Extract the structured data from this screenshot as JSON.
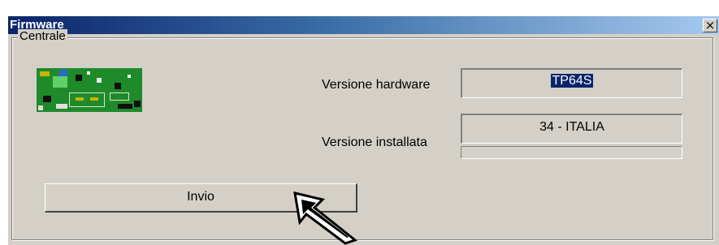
{
  "window": {
    "title": "Firmware",
    "close_symbol": "×"
  },
  "group": {
    "label": "Centrale"
  },
  "hardware": {
    "label": "Versione hardware",
    "value": "TP64S"
  },
  "installed": {
    "label": "Versione installata",
    "value": "34 - ITALIA",
    "progress": 0
  },
  "send_button": {
    "label": "Invio"
  },
  "icons": {
    "board": "circuit-board-icon",
    "cursor": "mouse-pointer-icon"
  },
  "colors": {
    "titlebar_start": "#0a246a",
    "titlebar_end": "#a6caf0",
    "face": "#d4d0c8",
    "selection": "#0a246a"
  }
}
